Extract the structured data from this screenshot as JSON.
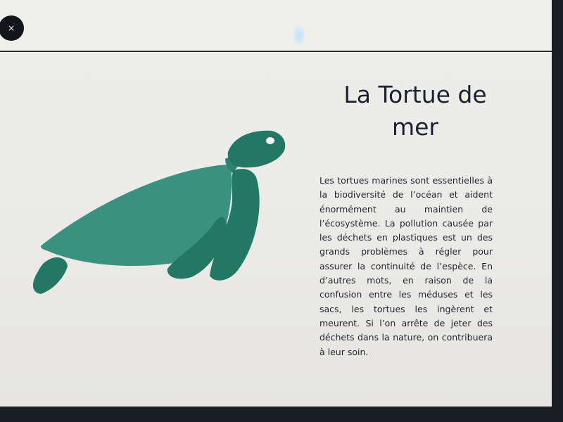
{
  "window": {
    "close_label": "×",
    "close_icon": "close-icon"
  },
  "article": {
    "title_line1": "La Tortue de",
    "title_line2": "mer",
    "body": "Les tortues marines sont essentielles à la biodiversité de l’océan et aident énormément au maintien de l’écosystème. La pollution causée par les déchets en plastiques est un des grands problèmes à régler pour assurer la continuité de l’espèce. En d’autres mots, en raison de la confusion entre les méduses et les sacs, les tortues les ingèrent et meurent. Si l’on arrête de jeter des déchets dans la nature, on contribuera à leur soin."
  },
  "illustration": {
    "icon": "sea-turtle-icon",
    "color_shell": "#3b917f",
    "color_limbs": "#227765",
    "color_eye": "#ffffff"
  }
}
